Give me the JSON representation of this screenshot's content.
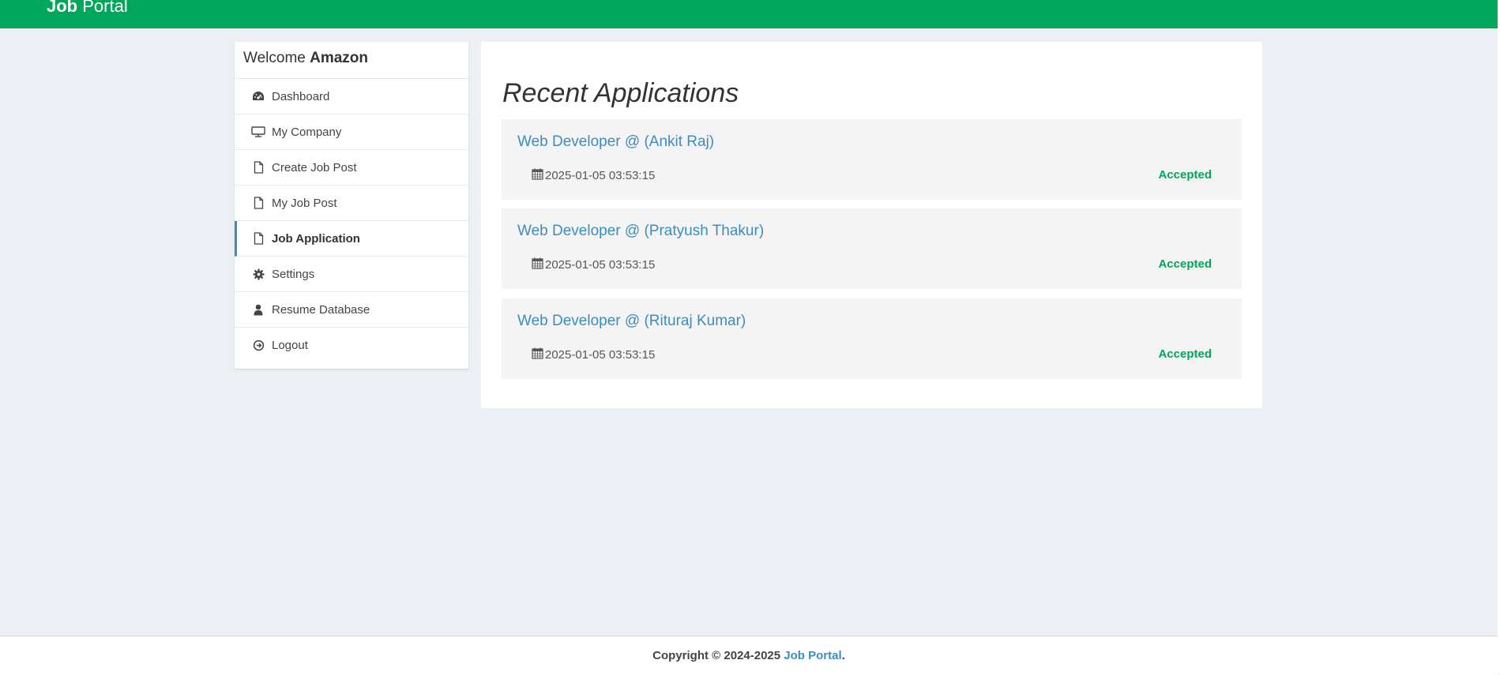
{
  "header": {
    "brand_bold": "Job",
    "brand_rest": "Portal"
  },
  "sidebar": {
    "welcome_prefix": "Welcome",
    "company_name": "Amazon",
    "items": [
      {
        "label": "Dashboard",
        "icon": "dashboard-icon"
      },
      {
        "label": "My Company",
        "icon": "desktop-icon"
      },
      {
        "label": "Create Job Post",
        "icon": "file-icon"
      },
      {
        "label": "My Job Post",
        "icon": "file-icon"
      },
      {
        "label": "Job Application",
        "icon": "file-icon",
        "active": true
      },
      {
        "label": "Settings",
        "icon": "gear-icon"
      },
      {
        "label": "Resume Database",
        "icon": "user-icon"
      },
      {
        "label": "Logout",
        "icon": "logout-icon"
      }
    ]
  },
  "main": {
    "title": "Recent Applications",
    "applications": [
      {
        "title": "Web Developer @ (Ankit Raj)",
        "date": "2025-01-05 03:53:15",
        "status": "Accepted"
      },
      {
        "title": "Web Developer @ (Pratyush Thakur)",
        "date": "2025-01-05 03:53:15",
        "status": "Accepted"
      },
      {
        "title": "Web Developer @ (Rituraj Kumar)",
        "date": "2025-01-05 03:53:15",
        "status": "Accepted"
      }
    ]
  },
  "footer": {
    "copyright": "Copyright © 2024-2025",
    "link_text": "Job Portal",
    "suffix": "."
  },
  "colors": {
    "header_green": "#00a65a",
    "link_blue": "#3c8dbc",
    "status_green": "#00a65a",
    "background": "#ecf0f5"
  }
}
